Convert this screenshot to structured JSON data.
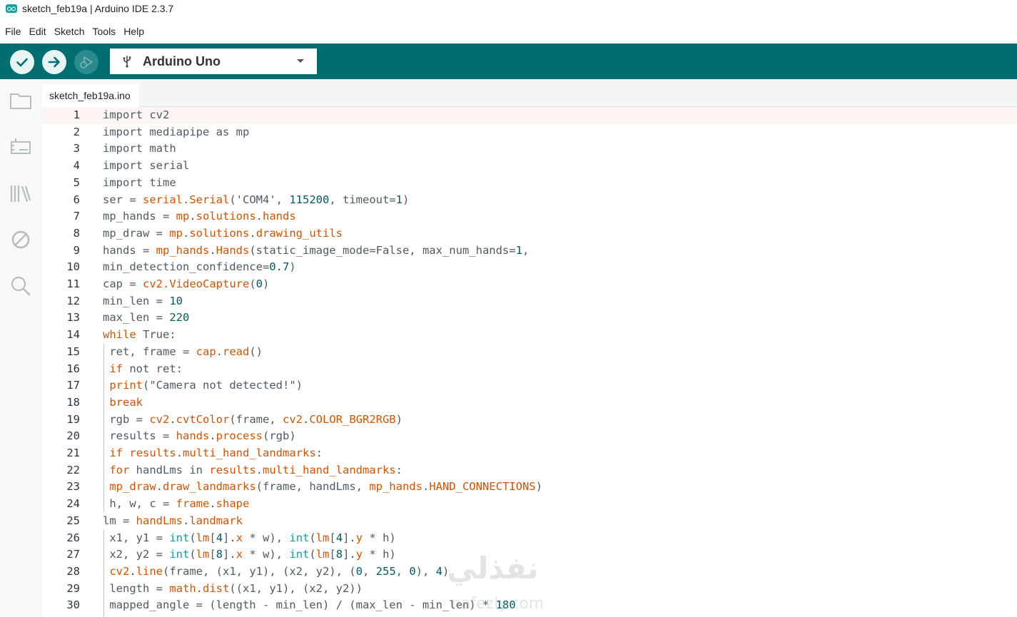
{
  "window": {
    "title": "sketch_feb19a | Arduino IDE 2.3.7",
    "logo_icon": "arduino-logo-icon"
  },
  "menu": [
    "File",
    "Edit",
    "Sketch",
    "Tools",
    "Help"
  ],
  "toolbar": {
    "verify_icon": "check-icon",
    "upload_icon": "arrow-right-icon",
    "debug_icon": "debug-icon",
    "board_name": "Arduino Uno",
    "board_icon": "usb-icon",
    "accent_color": "#006d70"
  },
  "sidebar": {
    "items": [
      {
        "name": "sketchbook",
        "icon": "folder-icon"
      },
      {
        "name": "boards-manager",
        "icon": "board-icon"
      },
      {
        "name": "library-manager",
        "icon": "library-icon"
      },
      {
        "name": "debug",
        "icon": "no-entry-icon"
      },
      {
        "name": "search",
        "icon": "search-icon"
      }
    ]
  },
  "editor": {
    "tab_label": "sketch_feb19a.ino",
    "lines": [
      {
        "n": "1",
        "parts": [
          {
            "t": "import cv2",
            "c": "p"
          }
        ]
      },
      {
        "n": "2",
        "parts": [
          {
            "t": "import mediapipe as mp",
            "c": "p"
          }
        ]
      },
      {
        "n": "3",
        "parts": [
          {
            "t": "import math",
            "c": "p"
          }
        ]
      },
      {
        "n": "4",
        "parts": [
          {
            "t": "import serial",
            "c": "p"
          }
        ]
      },
      {
        "n": "5",
        "parts": [
          {
            "t": "import time",
            "c": "p"
          }
        ]
      },
      {
        "n": "6",
        "parts": [
          {
            "t": "ser = ",
            "c": "p"
          },
          {
            "t": "serial.Serial",
            "c": "o"
          },
          {
            "t": "('COM4', ",
            "c": "p"
          },
          {
            "t": "115200",
            "c": "n"
          },
          {
            "t": ", timeout=",
            "c": "p"
          },
          {
            "t": "1",
            "c": "n"
          },
          {
            "t": ")",
            "c": "p"
          }
        ]
      },
      {
        "n": "7",
        "parts": [
          {
            "t": "mp_hands = ",
            "c": "p"
          },
          {
            "t": "mp",
            "c": "o"
          },
          {
            "t": ".",
            "c": "p"
          },
          {
            "t": "solutions",
            "c": "o"
          },
          {
            "t": ".",
            "c": "p"
          },
          {
            "t": "hands",
            "c": "o"
          }
        ]
      },
      {
        "n": "8",
        "parts": [
          {
            "t": "mp_draw = ",
            "c": "p"
          },
          {
            "t": "mp",
            "c": "o"
          },
          {
            "t": ".",
            "c": "p"
          },
          {
            "t": "solutions",
            "c": "o"
          },
          {
            "t": ".",
            "c": "p"
          },
          {
            "t": "drawing_utils",
            "c": "o"
          }
        ]
      },
      {
        "n": "9",
        "parts": [
          {
            "t": "hands = ",
            "c": "p"
          },
          {
            "t": "mp_hands",
            "c": "o"
          },
          {
            "t": ".",
            "c": "p"
          },
          {
            "t": "Hands",
            "c": "o"
          },
          {
            "t": "(static_image_mode=False, max_num_hands=",
            "c": "p"
          },
          {
            "t": "1",
            "c": "n"
          },
          {
            "t": ",",
            "c": "p"
          }
        ]
      },
      {
        "n": "10",
        "parts": [
          {
            "t": "min_detection_confidence=",
            "c": "p"
          },
          {
            "t": "0.7",
            "c": "n"
          },
          {
            "t": ")",
            "c": "p"
          }
        ]
      },
      {
        "n": "11",
        "parts": [
          {
            "t": "cap = ",
            "c": "p"
          },
          {
            "t": "cv2.VideoCapture",
            "c": "o"
          },
          {
            "t": "(",
            "c": "p"
          },
          {
            "t": "0",
            "c": "n"
          },
          {
            "t": ")",
            "c": "p"
          }
        ]
      },
      {
        "n": "12",
        "parts": [
          {
            "t": "min_len = ",
            "c": "p"
          },
          {
            "t": "10",
            "c": "n"
          }
        ]
      },
      {
        "n": "13",
        "parts": [
          {
            "t": "max_len = ",
            "c": "p"
          },
          {
            "t": "220",
            "c": "n"
          }
        ]
      },
      {
        "n": "14",
        "parts": [
          {
            "t": "while",
            "c": "o"
          },
          {
            "t": " True:",
            "c": "p"
          }
        ]
      },
      {
        "n": "15",
        "parts": [
          {
            "t": " ret, frame = ",
            "c": "p"
          },
          {
            "t": "cap",
            "c": "o"
          },
          {
            "t": ".",
            "c": "p"
          },
          {
            "t": "read",
            "c": "o"
          },
          {
            "t": "()",
            "c": "p"
          }
        ]
      },
      {
        "n": "16",
        "parts": [
          {
            "t": " ",
            "c": "p"
          },
          {
            "t": "if",
            "c": "o"
          },
          {
            "t": " not ret:",
            "c": "p"
          }
        ]
      },
      {
        "n": "17",
        "parts": [
          {
            "t": " ",
            "c": "p"
          },
          {
            "t": "print",
            "c": "o"
          },
          {
            "t": "(\"Camera not detected!\")",
            "c": "p"
          }
        ]
      },
      {
        "n": "18",
        "parts": [
          {
            "t": " ",
            "c": "p"
          },
          {
            "t": "break",
            "c": "o"
          }
        ]
      },
      {
        "n": "19",
        "parts": [
          {
            "t": " rgb = ",
            "c": "p"
          },
          {
            "t": "cv2",
            "c": "o"
          },
          {
            "t": ".",
            "c": "p"
          },
          {
            "t": "cvtColor",
            "c": "o"
          },
          {
            "t": "(frame, ",
            "c": "p"
          },
          {
            "t": "cv2",
            "c": "o"
          },
          {
            "t": ".",
            "c": "p"
          },
          {
            "t": "COLOR_BGR2RGB",
            "c": "o"
          },
          {
            "t": ")",
            "c": "p"
          }
        ]
      },
      {
        "n": "20",
        "parts": [
          {
            "t": " results = ",
            "c": "p"
          },
          {
            "t": "hands",
            "c": "o"
          },
          {
            "t": ".",
            "c": "p"
          },
          {
            "t": "process",
            "c": "o"
          },
          {
            "t": "(rgb)",
            "c": "p"
          }
        ]
      },
      {
        "n": "21",
        "parts": [
          {
            "t": " ",
            "c": "p"
          },
          {
            "t": "if",
            "c": "o"
          },
          {
            "t": " ",
            "c": "p"
          },
          {
            "t": "results",
            "c": "o"
          },
          {
            "t": ".",
            "c": "p"
          },
          {
            "t": "multi_hand_landmarks",
            "c": "o"
          },
          {
            "t": ":",
            "c": "p"
          }
        ]
      },
      {
        "n": "22",
        "parts": [
          {
            "t": " ",
            "c": "p"
          },
          {
            "t": "for",
            "c": "o"
          },
          {
            "t": " handLms in ",
            "c": "p"
          },
          {
            "t": "results",
            "c": "o"
          },
          {
            "t": ".",
            "c": "p"
          },
          {
            "t": "multi_hand_landmarks",
            "c": "o"
          },
          {
            "t": ":",
            "c": "p"
          }
        ]
      },
      {
        "n": "23",
        "parts": [
          {
            "t": " ",
            "c": "p"
          },
          {
            "t": "mp_draw",
            "c": "o"
          },
          {
            "t": ".",
            "c": "p"
          },
          {
            "t": "draw_landmarks",
            "c": "o"
          },
          {
            "t": "(frame, handLms, ",
            "c": "p"
          },
          {
            "t": "mp_hands",
            "c": "o"
          },
          {
            "t": ".",
            "c": "p"
          },
          {
            "t": "HAND_CONNECTIONS",
            "c": "o"
          },
          {
            "t": ")",
            "c": "p"
          }
        ]
      },
      {
        "n": "24",
        "parts": [
          {
            "t": " h, w, c = ",
            "c": "p"
          },
          {
            "t": "frame",
            "c": "o"
          },
          {
            "t": ".",
            "c": "p"
          },
          {
            "t": "shape",
            "c": "o"
          }
        ]
      },
      {
        "n": "25",
        "parts": [
          {
            "t": "lm = ",
            "c": "p"
          },
          {
            "t": "handLms",
            "c": "o"
          },
          {
            "t": ".",
            "c": "p"
          },
          {
            "t": "landmark",
            "c": "o"
          }
        ]
      },
      {
        "n": "26",
        "parts": [
          {
            "t": " x1, y1 = ",
            "c": "p"
          },
          {
            "t": "int",
            "c": "t"
          },
          {
            "t": "(",
            "c": "p"
          },
          {
            "t": "lm",
            "c": "o"
          },
          {
            "t": "[",
            "c": "p"
          },
          {
            "t": "4",
            "c": "n"
          },
          {
            "t": "].",
            "c": "p"
          },
          {
            "t": "x",
            "c": "o"
          },
          {
            "t": " * w), ",
            "c": "p"
          },
          {
            "t": "int",
            "c": "t"
          },
          {
            "t": "(",
            "c": "p"
          },
          {
            "t": "lm",
            "c": "o"
          },
          {
            "t": "[",
            "c": "p"
          },
          {
            "t": "4",
            "c": "n"
          },
          {
            "t": "].",
            "c": "p"
          },
          {
            "t": "y",
            "c": "o"
          },
          {
            "t": " * h)",
            "c": "p"
          }
        ]
      },
      {
        "n": "27",
        "parts": [
          {
            "t": " x2, y2 = ",
            "c": "p"
          },
          {
            "t": "int",
            "c": "t"
          },
          {
            "t": "(",
            "c": "p"
          },
          {
            "t": "lm",
            "c": "o"
          },
          {
            "t": "[",
            "c": "p"
          },
          {
            "t": "8",
            "c": "n"
          },
          {
            "t": "].",
            "c": "p"
          },
          {
            "t": "x",
            "c": "o"
          },
          {
            "t": " * w), ",
            "c": "p"
          },
          {
            "t": "int",
            "c": "t"
          },
          {
            "t": "(",
            "c": "p"
          },
          {
            "t": "lm",
            "c": "o"
          },
          {
            "t": "[",
            "c": "p"
          },
          {
            "t": "8",
            "c": "n"
          },
          {
            "t": "].",
            "c": "p"
          },
          {
            "t": "y",
            "c": "o"
          },
          {
            "t": " * h)",
            "c": "p"
          }
        ]
      },
      {
        "n": "28",
        "parts": [
          {
            "t": " ",
            "c": "p"
          },
          {
            "t": "cv2",
            "c": "o"
          },
          {
            "t": ".",
            "c": "p"
          },
          {
            "t": "line",
            "c": "o"
          },
          {
            "t": "(frame, (x1, y1), (x2, y2), (",
            "c": "p"
          },
          {
            "t": "0",
            "c": "n"
          },
          {
            "t": ", ",
            "c": "p"
          },
          {
            "t": "255",
            "c": "n"
          },
          {
            "t": ", ",
            "c": "p"
          },
          {
            "t": "0",
            "c": "n"
          },
          {
            "t": "), ",
            "c": "p"
          },
          {
            "t": "4",
            "c": "n"
          },
          {
            "t": ")",
            "c": "p"
          }
        ]
      },
      {
        "n": "29",
        "parts": [
          {
            "t": " length = ",
            "c": "p"
          },
          {
            "t": "math",
            "c": "o"
          },
          {
            "t": ".",
            "c": "p"
          },
          {
            "t": "dist",
            "c": "o"
          },
          {
            "t": "((x1, y1), (x2, y2))",
            "c": "p"
          }
        ]
      },
      {
        "n": "30",
        "parts": [
          {
            "t": " mapped_angle = (length - min_len) / (max_len - min_len) * ",
            "c": "p"
          },
          {
            "t": "180",
            "c": "n"
          }
        ]
      }
    ]
  },
  "syntax_colors": {
    "p": "#4e5b61",
    "o": "#d35400",
    "n": "#005c5f",
    "t": "#0ca1a6"
  },
  "watermark": {
    "arabic": "نفذلي",
    "latin": "nafezly.com"
  }
}
